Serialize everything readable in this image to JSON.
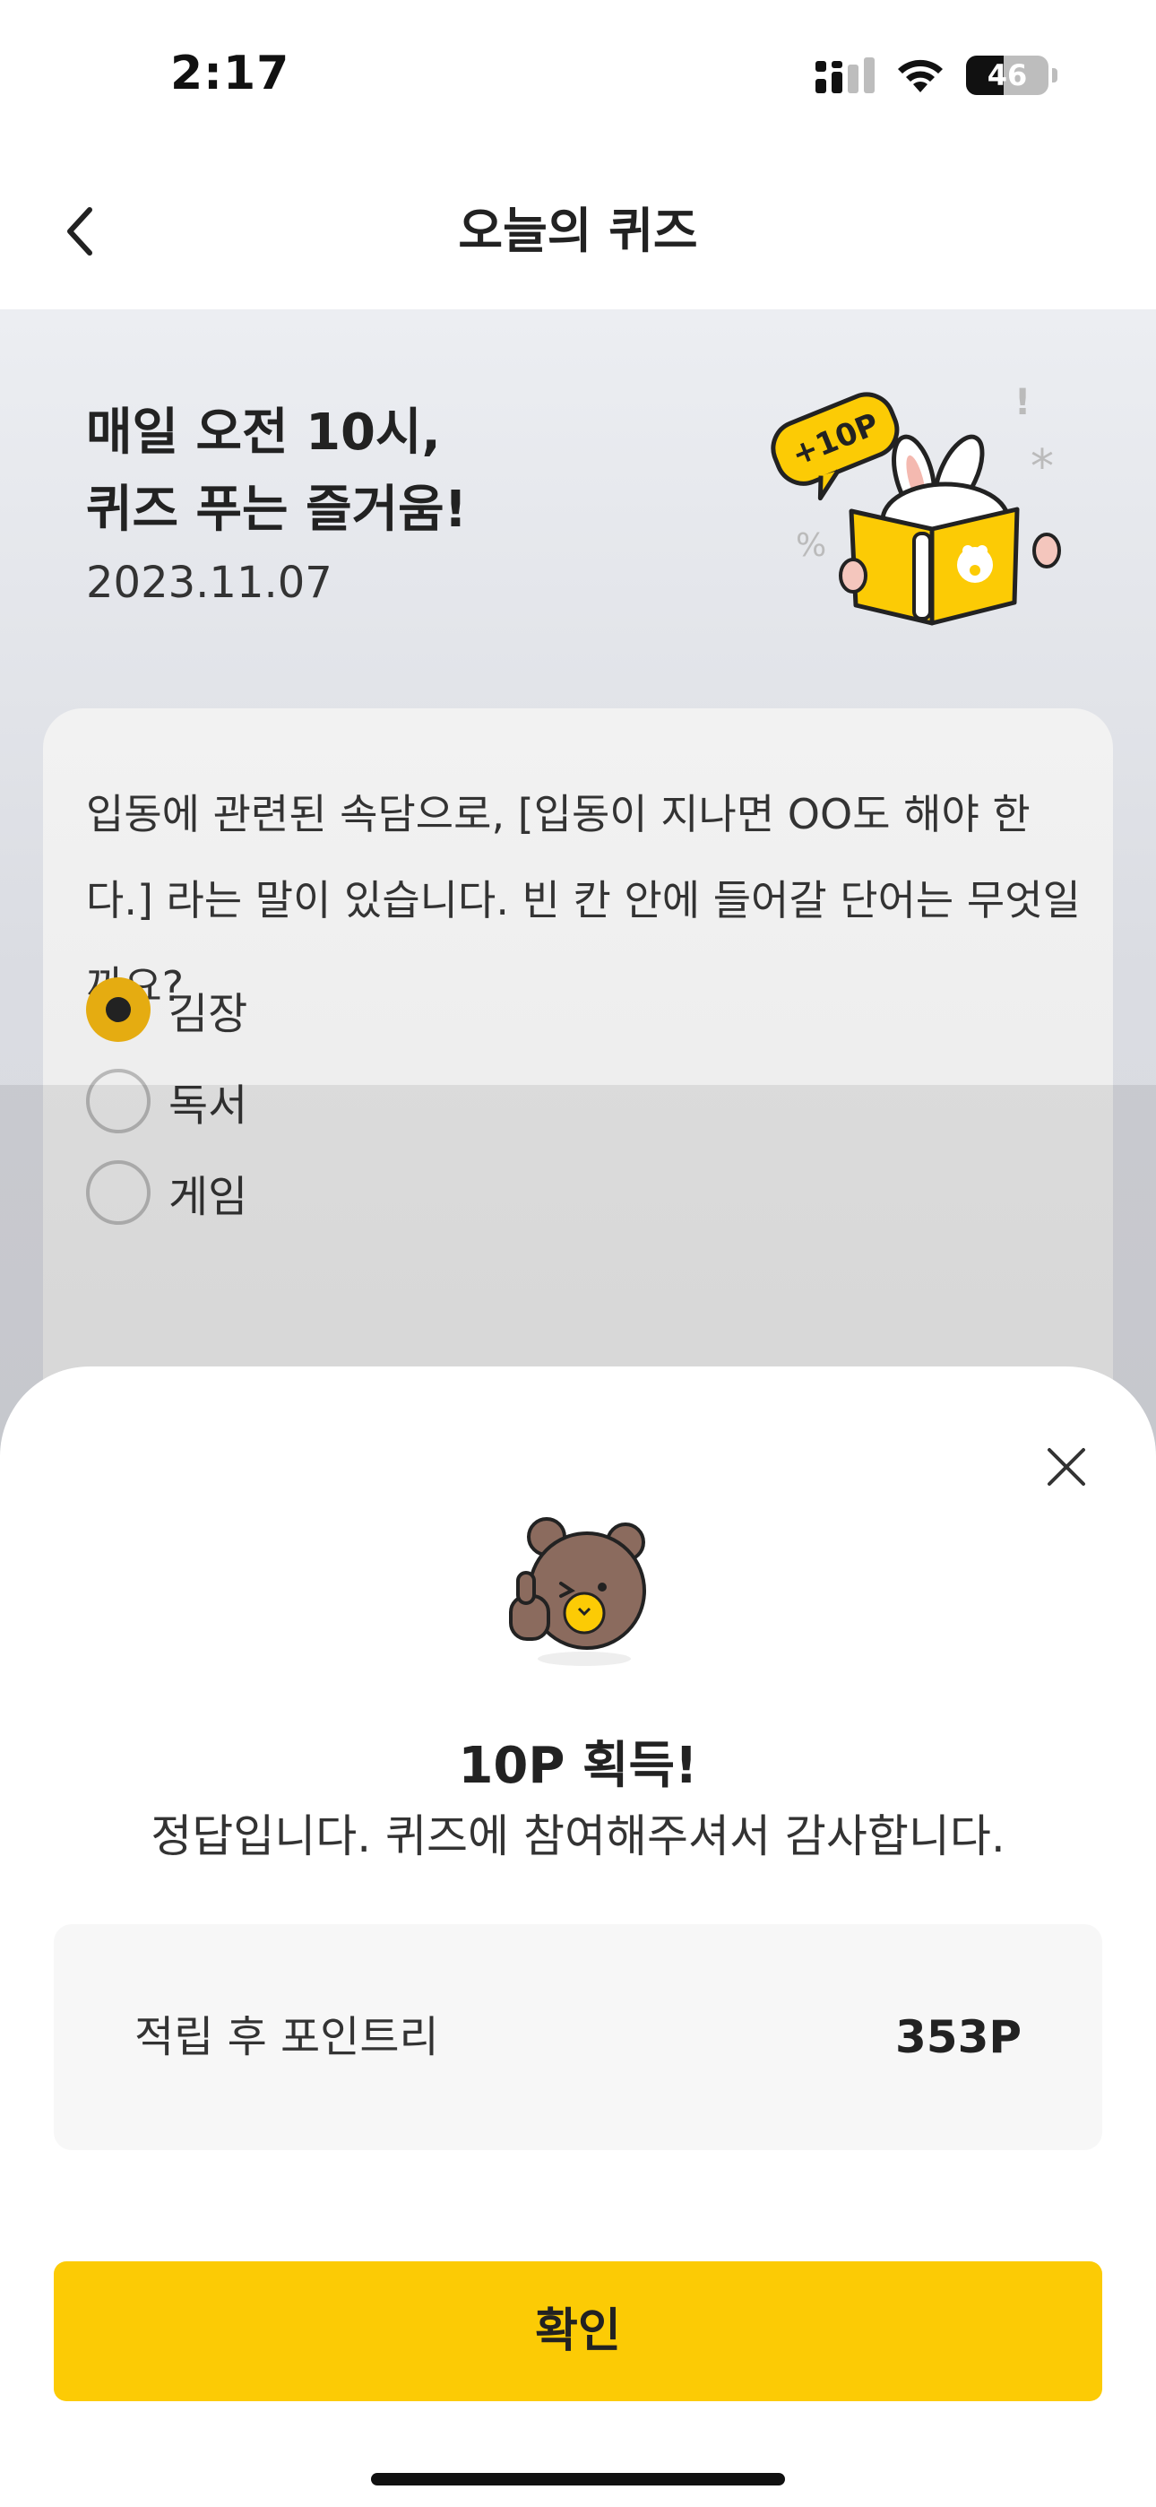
{
  "status_bar": {
    "time": "2:17",
    "battery_level": "46",
    "icons": [
      "signal-icon",
      "wifi-icon",
      "battery-icon"
    ]
  },
  "nav": {
    "title": "오늘의 퀴즈",
    "back_icon": "chevron-left-icon"
  },
  "hero": {
    "title": "매일 오전 10시,\n퀴즈 푸는 즐거움!",
    "date": "2023.11.07",
    "badge": "+10P"
  },
  "quiz": {
    "question": "입동에 관련된 속담으로, [입동이 지나면 OO도 해야 한다.] 라는 말이 있습니다. 빈 칸 안에 들어갈 단어는 무엇일까요?",
    "options": [
      {
        "label": "김장",
        "selected": true
      },
      {
        "label": "독서",
        "selected": false
      },
      {
        "label": "게임",
        "selected": false
      }
    ]
  },
  "sheet": {
    "title": "10P 획득!",
    "message": "정답입니다. 퀴즈에 참여해주셔서 감사합니다.",
    "points_label": "적립 후 포인트리",
    "points_value": "353P",
    "confirm_label": "확인",
    "close_icon": "close-icon"
  },
  "colors": {
    "accent_yellow": "#fccb05",
    "radio_selected": "#e5ac11",
    "bear_brown": "#8b6b5e"
  }
}
